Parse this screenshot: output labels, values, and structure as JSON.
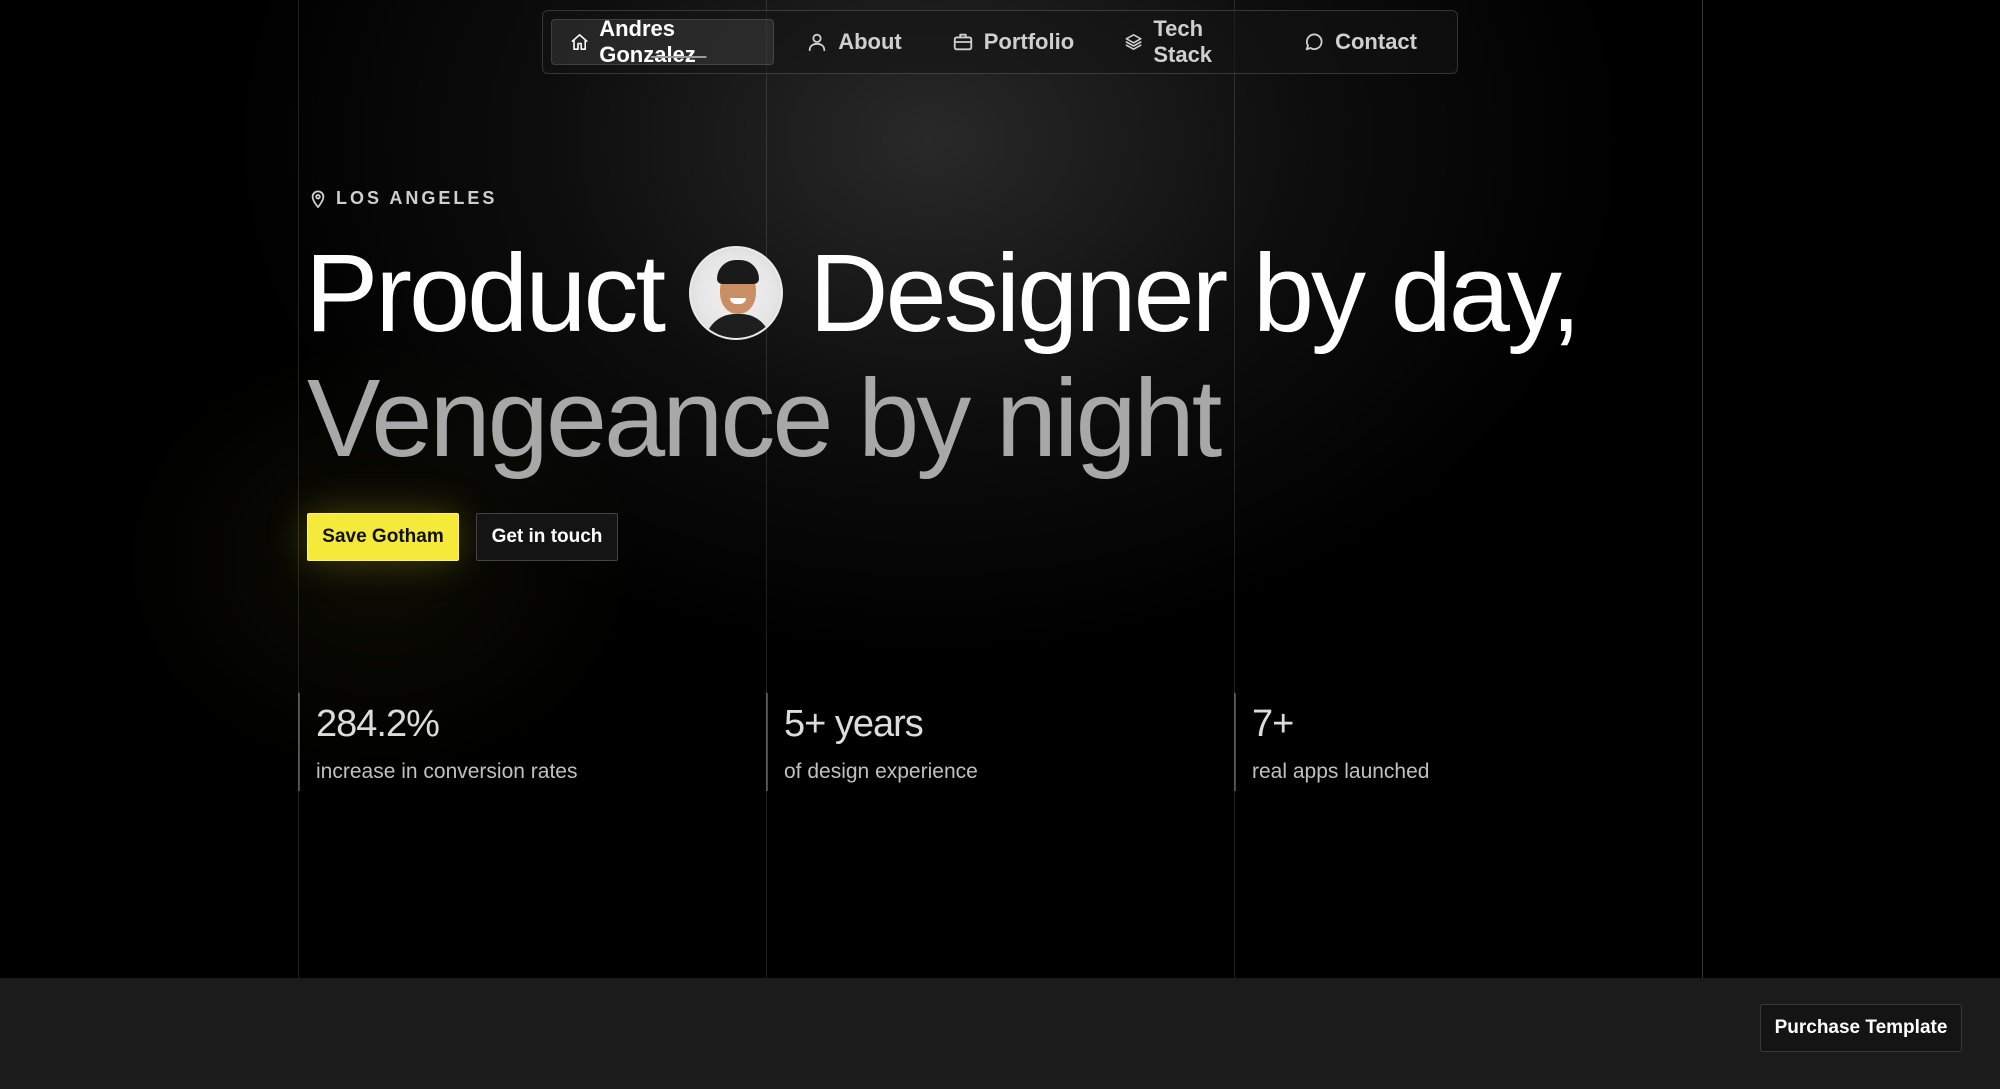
{
  "nav": {
    "items": [
      {
        "label": "Andres Gonzalez",
        "icon": "home-icon",
        "active": true
      },
      {
        "label": "About",
        "icon": "user-icon"
      },
      {
        "label": "Portfolio",
        "icon": "briefcase-icon"
      },
      {
        "label": "Tech Stack",
        "icon": "layers-icon"
      },
      {
        "label": "Contact",
        "icon": "chat-bubble-icon"
      }
    ]
  },
  "hero": {
    "location": "LOS ANGELES",
    "headline_part1": "Product",
    "headline_part2": "Designer by day,",
    "headline_line2": "Vengeance by night",
    "primary_button": "Save Gotham",
    "secondary_button": "Get in touch"
  },
  "stats": [
    {
      "value": "284.2%",
      "label": "increase in conversion rates"
    },
    {
      "value": "5+ years",
      "label": "of design experience"
    },
    {
      "value": "7+",
      "label": "real apps launched"
    }
  ],
  "footer": {
    "purchase_button": "Purchase Template"
  },
  "colors": {
    "accent": "#f5e93a",
    "background": "#000000",
    "footer": "#1b1b1b"
  }
}
